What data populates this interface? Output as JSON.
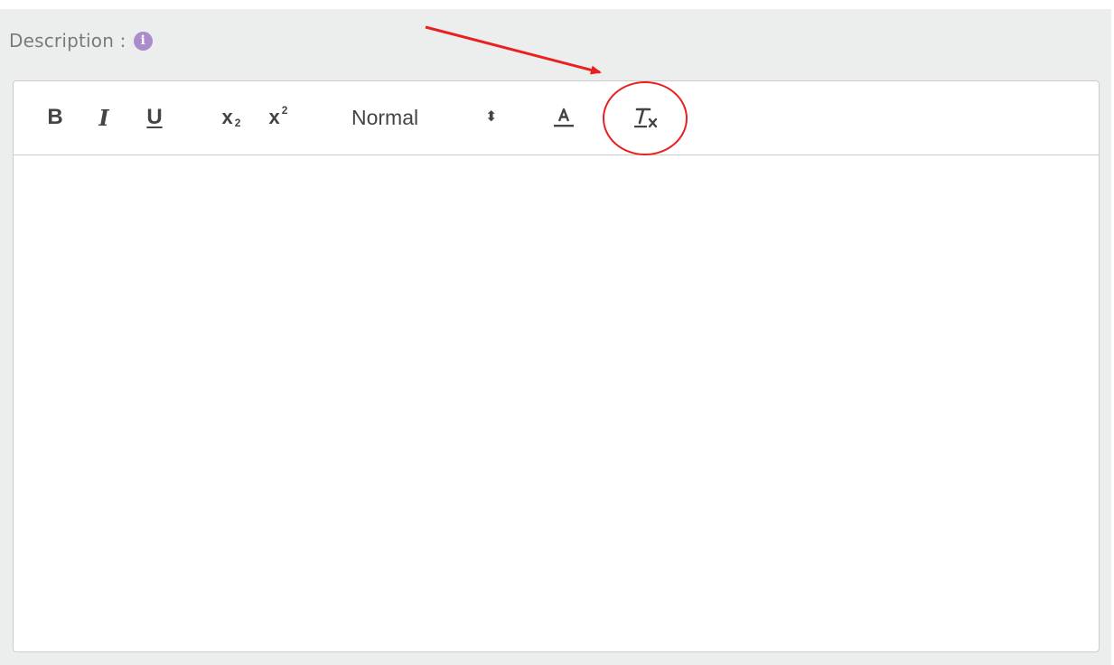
{
  "field": {
    "label": "Description :",
    "info_icon_glyph": "i"
  },
  "toolbar": {
    "bold": "B",
    "italic": "I",
    "underline": "U",
    "subscript_base": "x",
    "subscript_mark": "2",
    "superscript_base": "x",
    "superscript_mark": "2",
    "header_picker_value": "Normal",
    "header_picker_arrows": "⬍",
    "color_icon": "text-color-icon",
    "clean_icon": "clear-formatting-icon"
  },
  "editor": {
    "content": ""
  },
  "annotation": {
    "color": "#e8201f",
    "target": "clear-formatting-button"
  }
}
